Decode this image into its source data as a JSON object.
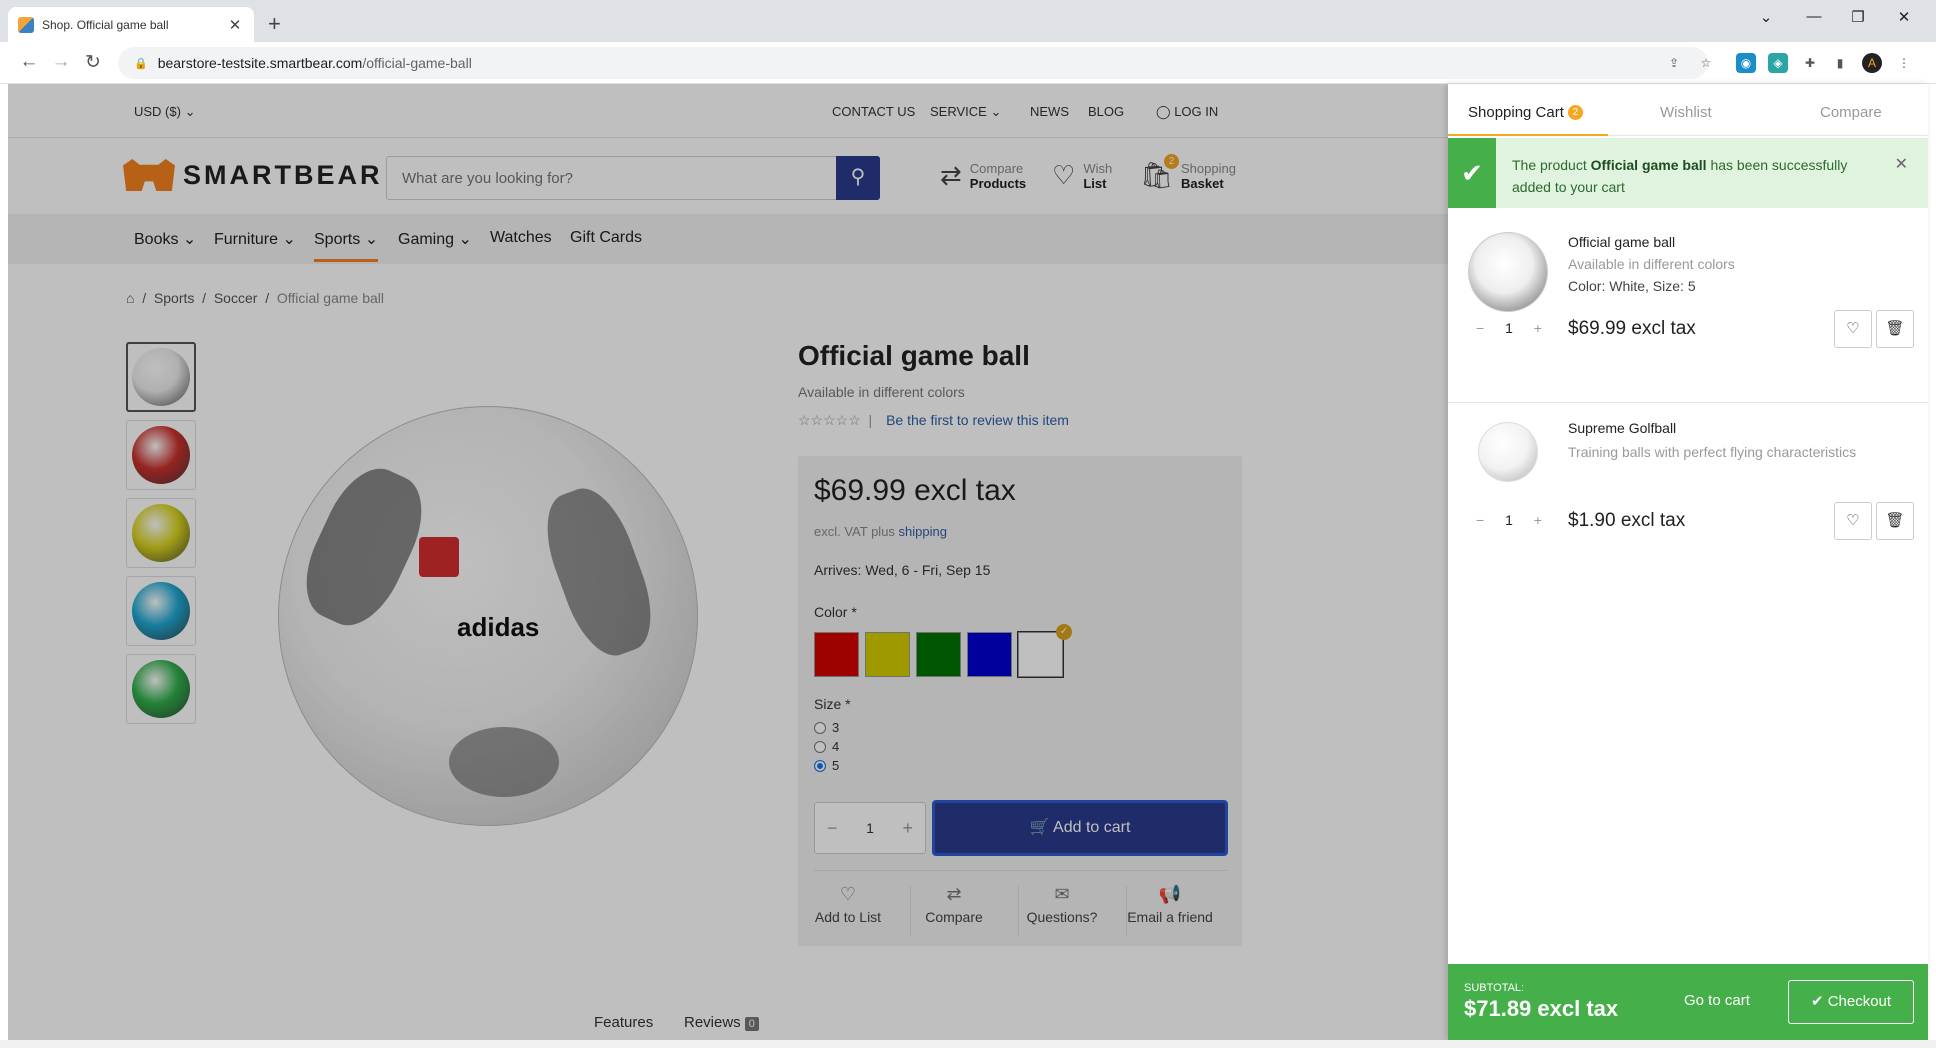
{
  "browser": {
    "tab_title": "Shop. Official game ball",
    "url_host": "bearstore-testsite.smartbear.com",
    "url_path": "/official-game-ball"
  },
  "topbar": {
    "currency": "USD  ($)",
    "contact": "CONTACT US",
    "service": "SERVICE",
    "news": "NEWS",
    "blog": "BLOG",
    "login": "LOG IN"
  },
  "header": {
    "logo_text": "SMARTBEAR",
    "search_placeholder": "What are you looking for?",
    "compare_top": "Compare",
    "compare_bottom": "Products",
    "wish_top": "Wish",
    "wish_bottom": "List",
    "basket_top": "Shopping",
    "basket_bottom": "Basket",
    "basket_count": "2"
  },
  "nav": {
    "books": "Books",
    "furniture": "Furniture",
    "sports": "Sports",
    "gaming": "Gaming",
    "watches": "Watches",
    "gift_cards": "Gift Cards"
  },
  "breadcrumb": {
    "sports": "Sports",
    "soccer": "Soccer",
    "current": "Official game ball"
  },
  "thumbs": [
    "#ececec",
    "#c9312e",
    "#d8d21f",
    "#1ea7d3",
    "#2fae4a"
  ],
  "product": {
    "title": "Official game ball",
    "subtitle": "Available in different colors",
    "review_link": "Be the first to review this item",
    "price": "$69.99 excl tax",
    "vat": "excl. VAT plus",
    "shipping": "shipping",
    "arrives": "Arrives: Wed, 6 - Fri, Sep 15",
    "color_label": "Color *",
    "colors": [
      "#d40000",
      "#d4cc00",
      "#007300",
      "#0000d4",
      "#ffffff"
    ],
    "selected_color": "White",
    "size_label": "Size *",
    "sizes": [
      "3",
      "4",
      "5"
    ],
    "selected_size": "5",
    "quantity": "1",
    "add_to_cart": "Add to cart",
    "actions": {
      "add_to_list": "Add to List",
      "compare": "Compare",
      "questions": "Questions?",
      "email": "Email a friend"
    },
    "tabs": {
      "features": "Features",
      "reviews": "Reviews",
      "reviews_count": "0"
    }
  },
  "cart": {
    "tab_cart": "Shopping Cart",
    "tab_cart_count": "2",
    "tab_wishlist": "Wishlist",
    "tab_compare": "Compare",
    "notice_pre": "The product",
    "notice_product": "Official game ball",
    "notice_post": "has been successfully added to your cart",
    "items": [
      {
        "name": "Official game ball",
        "desc": "Available in different colors",
        "attrs": "Color: White, Size: 5",
        "qty": "1",
        "price": "$69.99 excl tax"
      },
      {
        "name": "Supreme Golfball",
        "desc": "Training balls with perfect flying characteristics",
        "attrs": "",
        "qty": "1",
        "price": "$1.90 excl tax"
      }
    ],
    "subtotal_label": "SUBTOTAL:",
    "subtotal_value": "$71.89 excl tax",
    "go_to_cart": "Go to cart",
    "checkout": "Checkout"
  }
}
